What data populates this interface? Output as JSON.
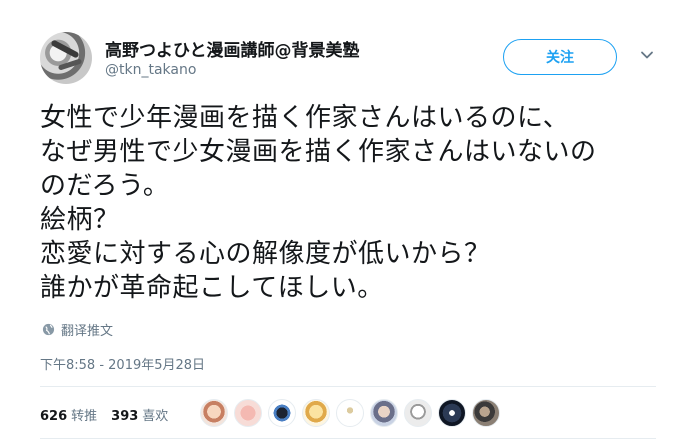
{
  "author": {
    "display_name": "高野つよひと漫画講師@背景美塾",
    "handle": "@tkn_takano",
    "avatar_icon": "user-avatar-icon"
  },
  "follow_button": {
    "label": "关注",
    "color": "#1da1f2"
  },
  "menu_icon": "chevron-down-icon",
  "tweet": {
    "lines": [
      "女性で少年漫画を描く作家さんはいるのに、",
      "なぜ男性で少女漫画を描く作家さんはいないの",
      "のだろう。",
      "絵柄？",
      "恋愛に対する心の解像度が低いから？",
      "誰かが革命起こしてほしい。"
    ]
  },
  "translate": {
    "label": "翻译推文",
    "icon": "globe-icon"
  },
  "timestamp": "下午8:58 - 2019年5月28日",
  "stats": {
    "retweets": {
      "count": "626",
      "label": "转推"
    },
    "likes": {
      "count": "393",
      "label": "喜欢"
    }
  },
  "colors": {
    "accent": "#1da1f2",
    "secondary_text": "#657786",
    "divider": "#e6ecf0"
  }
}
